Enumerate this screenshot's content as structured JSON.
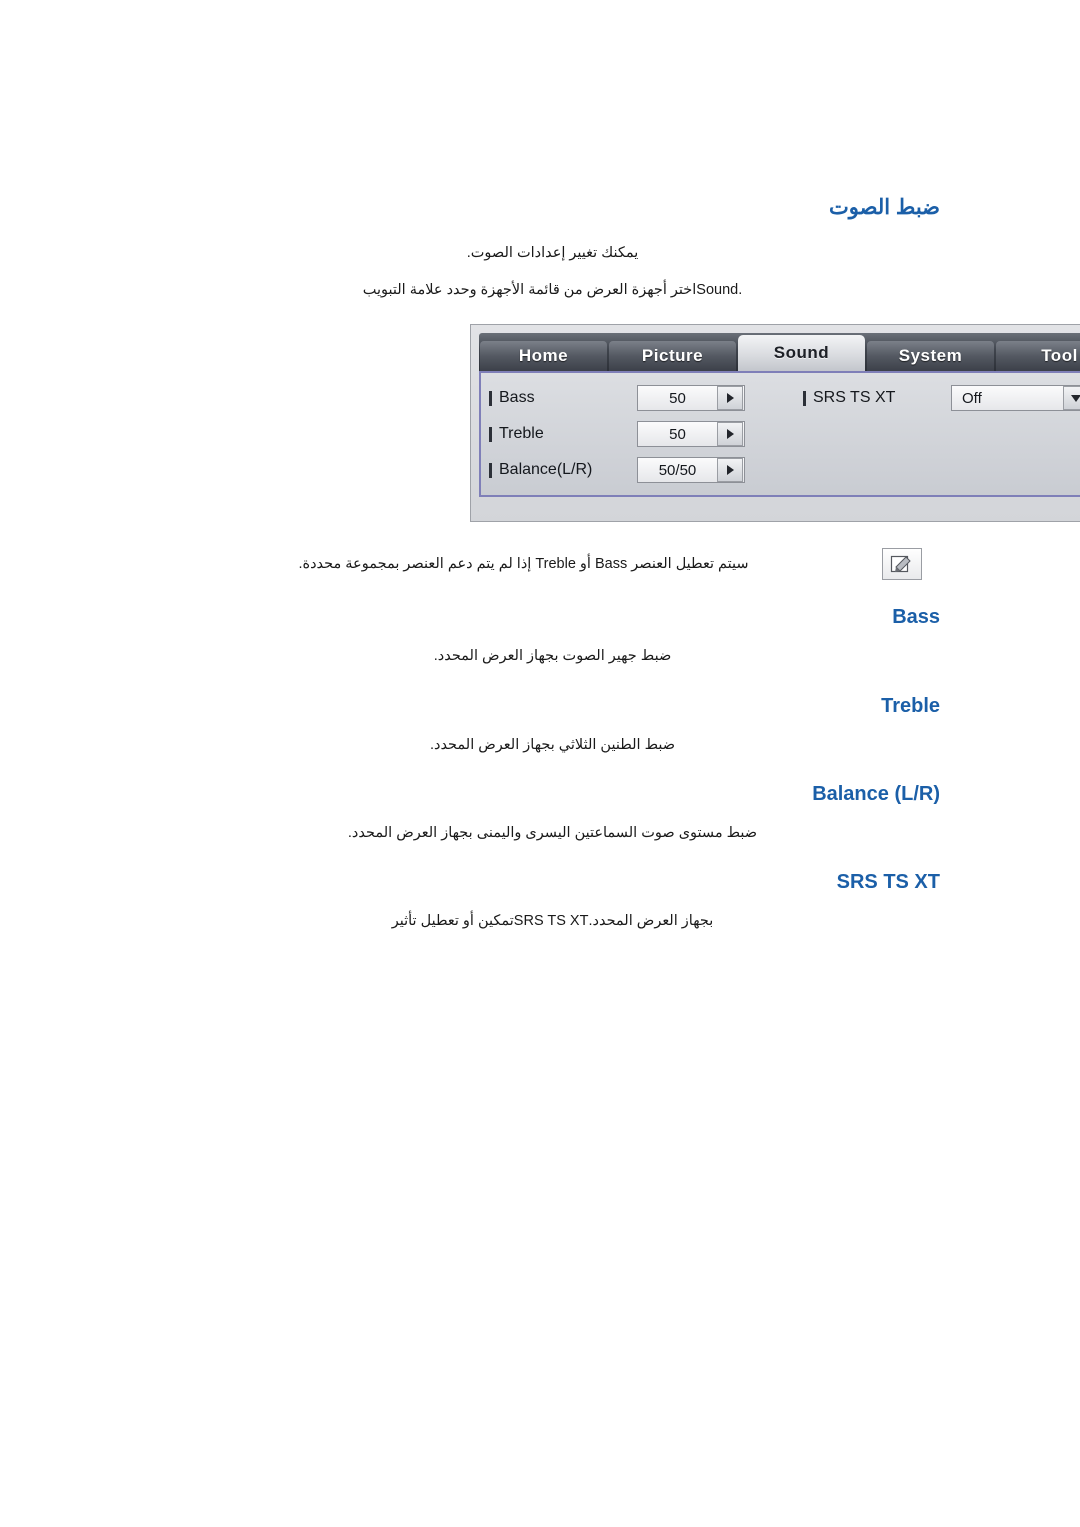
{
  "page": {
    "section_title": "ضبط الصوت",
    "intro_line_1": "يمكنك تغيير إعدادات الصوت.",
    "intro_line_2_prefix": "اختر أجهزة العرض من قائمة الأجهزة وحدد علامة التبويب ",
    "intro_line_2_word": "Sound",
    "intro_line_2_suffix": "."
  },
  "osd": {
    "tabs": [
      {
        "label": "Home",
        "active": false
      },
      {
        "label": "Picture",
        "active": false
      },
      {
        "label": "Sound",
        "active": true
      },
      {
        "label": "System",
        "active": false
      },
      {
        "label": "Tool",
        "active": false
      }
    ],
    "left_rows": [
      {
        "label": "Bass",
        "value": "50",
        "control": "stepper"
      },
      {
        "label": "Treble",
        "value": "50",
        "control": "stepper"
      },
      {
        "label": "Balance(L/R)",
        "value": "50/50",
        "control": "stepper"
      }
    ],
    "right_rows": [
      {
        "label": "SRS TS XT",
        "value": "Off",
        "control": "dropdown"
      }
    ]
  },
  "note": {
    "text_start": "سيتم تعطيل العنصر ",
    "bass": "Bass",
    "mid_or": " أو ",
    "treble": "Treble",
    "text_end": " إذا لم يتم دعم العنصر بمجموعة محددة.",
    "icon": "note-pencil-icon"
  },
  "sections": [
    {
      "title": "Bass",
      "desc": "ضبط جهير الصوت بجهاز العرض المحدد."
    },
    {
      "title": "Treble",
      "desc": "ضبط الطنين الثلاثي بجهاز العرض المحدد."
    },
    {
      "title": "Balance (L/R)",
      "desc": "ضبط مستوى صوت السماعتين اليسرى واليمنى بجهاز العرض المحدد."
    },
    {
      "title": "SRS TS XT",
      "desc_prefix": "تمكين أو تعطيل تأثير ",
      "desc_ltr": "SRS TS XT",
      "desc_suffix": " بجهاز العرض المحدد."
    }
  ],
  "colors": {
    "heading": "#1b5fa8",
    "text": "#1a1a1a",
    "osd_border": "#7f7fb8"
  }
}
